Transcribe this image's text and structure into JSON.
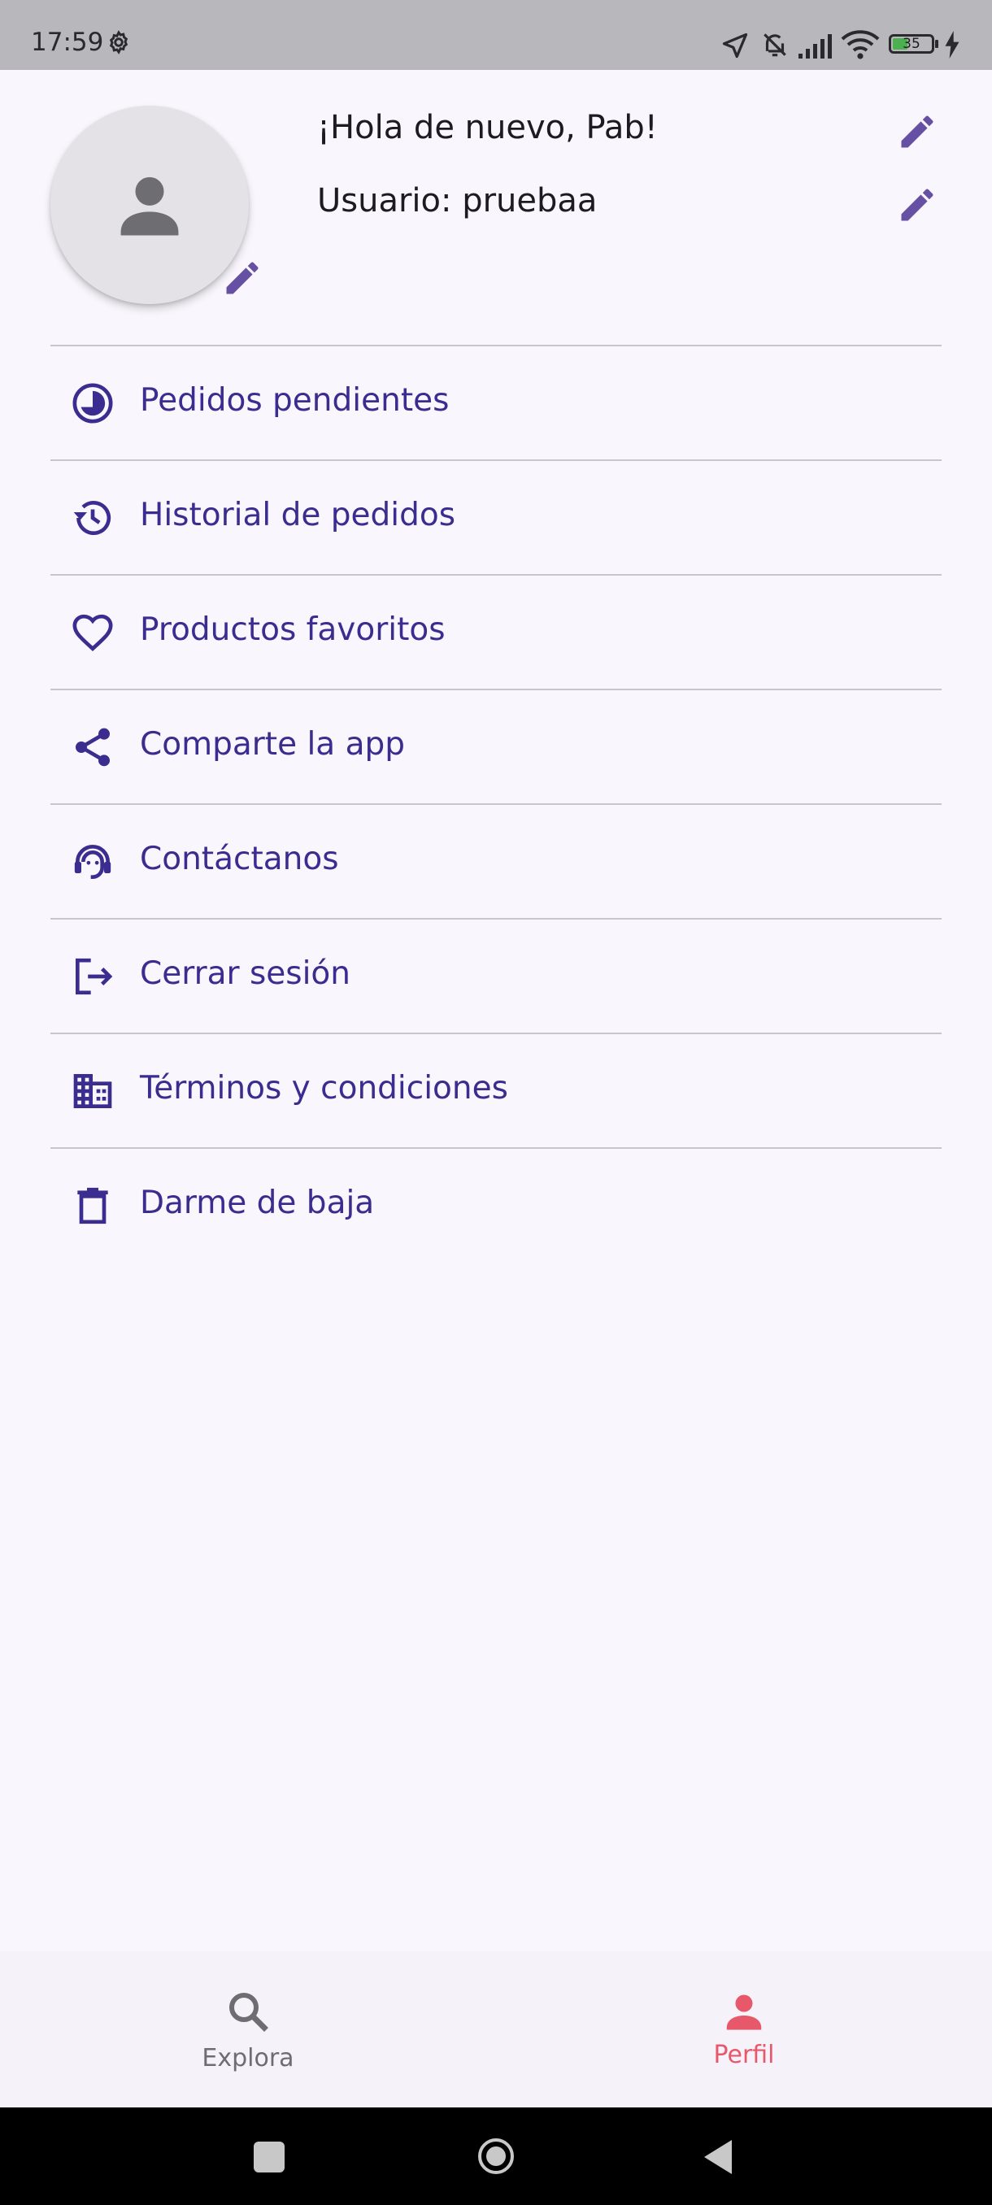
{
  "status_bar": {
    "time": "17:59",
    "battery_level": "35",
    "icons": [
      "gear-icon",
      "location-arrow-icon",
      "bell-off-icon",
      "signal-icon",
      "wifi-icon",
      "battery-icon",
      "charging-bolt-icon"
    ]
  },
  "profile": {
    "greeting": "¡Hola de nuevo, Pab!",
    "username": "Usuario: pruebaa"
  },
  "menu": {
    "items": [
      {
        "label": "Pedidos pendientes",
        "icon": "pie-clock-icon"
      },
      {
        "label": "Historial de pedidos",
        "icon": "history-icon"
      },
      {
        "label": "Productos favoritos",
        "icon": "heart-icon"
      },
      {
        "label": "Comparte la app",
        "icon": "share-icon"
      },
      {
        "label": "Contáctanos",
        "icon": "support-agent-icon"
      },
      {
        "label": "Cerrar sesión",
        "icon": "logout-icon"
      },
      {
        "label": "Términos y condiciones",
        "icon": "building-icon"
      },
      {
        "label": "Darme de baja",
        "icon": "trash-icon"
      }
    ]
  },
  "bottom_nav": {
    "explore_label": "Explora",
    "profile_label": "Perfil",
    "active": "Perfil"
  },
  "colors": {
    "accent": "#3b2d8f",
    "edit_icon": "#6650a4",
    "active_nav": "#e8586b",
    "inactive_nav": "#6e6e72",
    "background": "#f9f7fd"
  }
}
